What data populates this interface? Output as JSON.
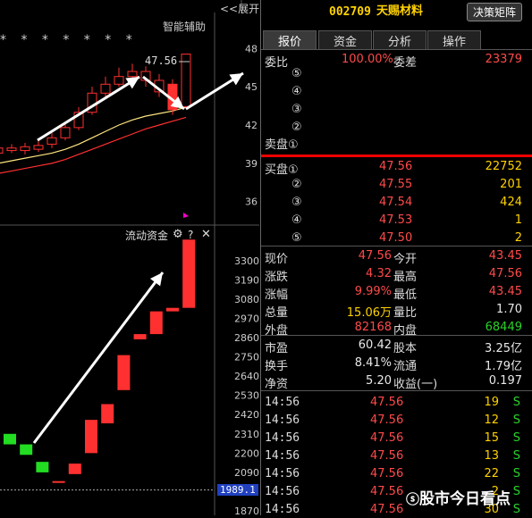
{
  "chart_panel": {
    "expand_label": "<<展开",
    "assist_label": "智能辅助",
    "stars": "* * * * * * *",
    "peak_label": "47.56",
    "price_axis": [
      "48",
      "45",
      "42",
      "39",
      "36"
    ],
    "flow_title": "流动资金",
    "flow_axis": [
      "3300",
      "3190",
      "3080",
      "2970",
      "2860",
      "2750",
      "2640",
      "2530",
      "2420",
      "2310",
      "2200",
      "2090",
      "1870"
    ],
    "current_value_badge": "1989.1"
  },
  "chart_data": [
    {
      "type": "candlestick",
      "title": "",
      "yticks": [
        36,
        39,
        42,
        45,
        48
      ],
      "ylim": [
        35,
        49
      ],
      "peak_annotation": 47.56,
      "candles": [
        {
          "o": 39.8,
          "c": 40.2,
          "h": 40.6,
          "l": 39.5,
          "color": "red"
        },
        {
          "o": 40.2,
          "c": 40.0,
          "h": 40.5,
          "l": 39.8,
          "color": "red"
        },
        {
          "o": 40.0,
          "c": 40.3,
          "h": 40.6,
          "l": 39.7,
          "color": "red"
        },
        {
          "o": 40.1,
          "c": 40.4,
          "h": 40.8,
          "l": 39.9,
          "color": "red"
        },
        {
          "o": 40.5,
          "c": 41.0,
          "h": 41.4,
          "l": 40.2,
          "color": "red"
        },
        {
          "o": 41.0,
          "c": 41.8,
          "h": 42.2,
          "l": 40.8,
          "color": "red"
        },
        {
          "o": 41.8,
          "c": 43.0,
          "h": 43.4,
          "l": 41.6,
          "color": "red"
        },
        {
          "o": 43.0,
          "c": 44.5,
          "h": 45.0,
          "l": 42.8,
          "color": "red"
        },
        {
          "o": 44.5,
          "c": 45.2,
          "h": 45.8,
          "l": 44.2,
          "color": "red"
        },
        {
          "o": 45.2,
          "c": 45.8,
          "h": 46.5,
          "l": 45.0,
          "color": "red"
        },
        {
          "o": 45.8,
          "c": 46.2,
          "h": 46.8,
          "l": 45.5,
          "color": "red"
        },
        {
          "o": 46.2,
          "c": 45.5,
          "h": 46.6,
          "l": 45.0,
          "color": "red"
        },
        {
          "o": 45.5,
          "c": 44.6,
          "h": 46.0,
          "l": 44.2,
          "color": "red"
        },
        {
          "o": 45.2,
          "c": 43.2,
          "h": 45.6,
          "l": 42.8,
          "color": "red"
        },
        {
          "o": 43.45,
          "c": 47.56,
          "h": 47.56,
          "l": 43.45,
          "color": "red"
        }
      ],
      "ma_lines": [
        {
          "color": "#ffe680",
          "values": [
            39.0,
            39.2,
            39.4,
            39.6,
            39.8,
            40.1,
            40.5,
            41.0,
            41.5,
            42.0,
            42.4,
            42.7,
            42.9,
            43.1,
            43.4
          ]
        },
        {
          "color": "#ff3030",
          "values": [
            38.2,
            38.4,
            38.6,
            38.8,
            39.0,
            39.3,
            39.7,
            40.1,
            40.5,
            40.9,
            41.3,
            41.7,
            42.0,
            42.3,
            42.6
          ]
        }
      ]
    },
    {
      "type": "bar",
      "title": "流动资金",
      "ylim": [
        1870,
        3350
      ],
      "yticks": [
        1870,
        2090,
        2200,
        2310,
        2420,
        2530,
        2640,
        2750,
        2860,
        2970,
        3080,
        3190,
        3300
      ],
      "bars": [
        {
          "o": 2310,
          "c": 2250,
          "color": "green"
        },
        {
          "o": 2250,
          "c": 2190,
          "color": "green"
        },
        {
          "o": 2150,
          "c": 2090,
          "color": "green"
        },
        {
          "o": 2040,
          "c": 2040,
          "color": "red"
        },
        {
          "o": 2080,
          "c": 2140,
          "color": "red"
        },
        {
          "o": 2200,
          "c": 2390,
          "color": "red"
        },
        {
          "o": 2370,
          "c": 2480,
          "color": "red"
        },
        {
          "o": 2560,
          "c": 2760,
          "color": "red"
        },
        {
          "o": 2850,
          "c": 2880,
          "color": "red"
        },
        {
          "o": 2880,
          "c": 3010,
          "color": "red"
        },
        {
          "o": 3010,
          "c": 3030,
          "color": "red"
        },
        {
          "o": 3030,
          "c": 3420,
          "color": "red"
        }
      ],
      "current_value": 1989.1
    }
  ],
  "header": {
    "code": "002709",
    "name": "天赐材料",
    "button": "决策矩阵"
  },
  "tabs": [
    "报价",
    "资金",
    "分析",
    "操作"
  ],
  "weibi": {
    "label": "委比",
    "value": "100.00%",
    "diff_label": "委差",
    "diff_value": "23379"
  },
  "sell_levels": [
    "⑤",
    "④",
    "③",
    "②",
    "卖盘①"
  ],
  "buy_levels": [
    {
      "label": "买盘①",
      "price": "47.56",
      "vol": "22752"
    },
    {
      "label": "②",
      "price": "47.55",
      "vol": "201"
    },
    {
      "label": "③",
      "price": "47.54",
      "vol": "424"
    },
    {
      "label": "④",
      "price": "47.53",
      "vol": "1"
    },
    {
      "label": "⑤",
      "price": "47.50",
      "vol": "2"
    }
  ],
  "stats": [
    {
      "l1": "现价",
      "v1": "47.56",
      "l2": "今开",
      "v2": "43.45"
    },
    {
      "l1": "涨跌",
      "v1": "4.32",
      "l2": "最高",
      "v2": "47.56"
    },
    {
      "l1": "涨幅",
      "v1": "9.99%",
      "l2": "最低",
      "v2": "43.45"
    },
    {
      "l1": "总量",
      "v1": "15.06万",
      "l2": "量比",
      "v2": "1.70"
    },
    {
      "l1": "外盘",
      "v1": "82168",
      "l2": "内盘",
      "v2": "68449"
    }
  ],
  "stats2": [
    {
      "l1": "市盈",
      "v1": "60.42",
      "l2": "股本",
      "v2": "3.25亿"
    },
    {
      "l1": "换手",
      "v1": "8.41%",
      "l2": "流通",
      "v2": "1.79亿"
    },
    {
      "l1": "净资",
      "v1": "5.20",
      "l2": "收益(一)",
      "v2": "0.197"
    }
  ],
  "ticks": [
    {
      "time": "14:56",
      "price": "47.56",
      "vol": "19",
      "side": "S"
    },
    {
      "time": "14:56",
      "price": "47.56",
      "vol": "12",
      "side": "S"
    },
    {
      "time": "14:56",
      "price": "47.56",
      "vol": "15",
      "side": "S"
    },
    {
      "time": "14:56",
      "price": "47.56",
      "vol": "13",
      "side": "S"
    },
    {
      "time": "14:56",
      "price": "47.56",
      "vol": "22",
      "side": "S"
    },
    {
      "time": "14:56",
      "price": "47.56",
      "vol": "2",
      "side": "S"
    },
    {
      "time": "14:56",
      "price": "47.56",
      "vol": "30",
      "side": "S"
    }
  ],
  "watermark": "股市今日看点"
}
